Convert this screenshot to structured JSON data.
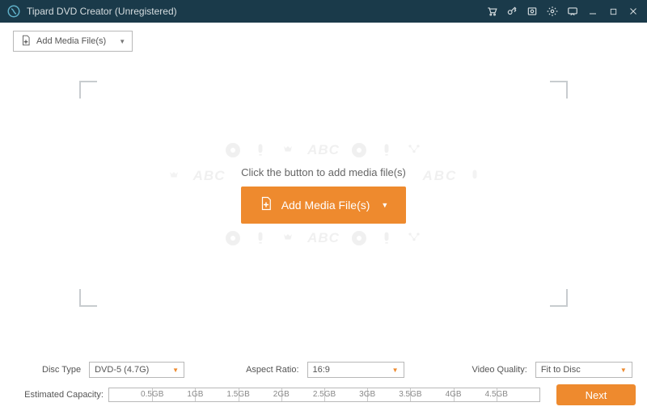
{
  "titlebar": {
    "title": "Tipard DVD Creator (Unregistered)"
  },
  "toolbar": {
    "add_media_label": "Add Media File(s)"
  },
  "dropzone": {
    "hint": "Click the button to add media file(s)",
    "add_media_label": "Add Media File(s)",
    "watermark_text": "ABC"
  },
  "footer": {
    "disc_type": {
      "label": "Disc Type",
      "value": "DVD-5 (4.7G)"
    },
    "aspect_ratio": {
      "label": "Aspect Ratio:",
      "value": "16:9"
    },
    "video_quality": {
      "label": "Video Quality:",
      "value": "Fit to Disc"
    },
    "capacity": {
      "label": "Estimated Capacity:",
      "ticks": [
        "0.5GB",
        "1GB",
        "1.5GB",
        "2GB",
        "2.5GB",
        "3GB",
        "3.5GB",
        "4GB",
        "4.5GB"
      ]
    },
    "next_label": "Next"
  }
}
